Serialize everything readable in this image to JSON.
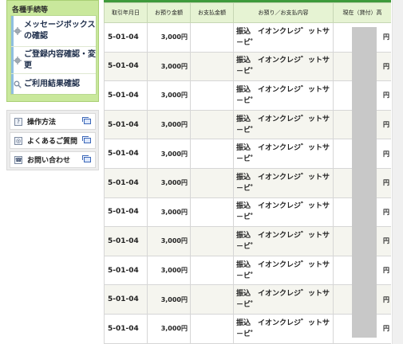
{
  "sidebar": {
    "procedures_title": "各種手続等",
    "procedures": [
      {
        "label": "メッセージボックスの確認",
        "icon": "gear-icon"
      },
      {
        "label": "ご登録内容確認・変更",
        "icon": "gear-icon"
      },
      {
        "label": "ご利用結果確認",
        "icon": "magnifier-icon"
      }
    ],
    "help": [
      {
        "label": "操作方法",
        "icon": "question-icon"
      },
      {
        "label": "よくあるご質問",
        "icon": "faq-icon"
      },
      {
        "label": "お問い合わせ",
        "icon": "phone-icon"
      }
    ]
  },
  "table": {
    "headers": [
      "取引年月日",
      "お預り金額",
      "お支払金額",
      "お預り／お支払内容",
      "現在（貸付）高"
    ],
    "rows": [
      {
        "date": "5-01-04",
        "deposit": "3,000円",
        "payment": "",
        "desc": "振込　イオンクレジ゛ットサ－ビ゜",
        "balance": "円"
      },
      {
        "date": "5-01-04",
        "deposit": "3,000円",
        "payment": "",
        "desc": "振込　イオンクレジ゛ットサ－ビ゜",
        "balance": "円"
      },
      {
        "date": "5-01-04",
        "deposit": "3,000円",
        "payment": "",
        "desc": "振込　イオンクレジ゛ットサ－ビ゜",
        "balance": "円"
      },
      {
        "date": "5-01-04",
        "deposit": "3,000円",
        "payment": "",
        "desc": "振込　イオンクレジ゛ットサ－ビ゜",
        "balance": "円"
      },
      {
        "date": "5-01-04",
        "deposit": "3,000円",
        "payment": "",
        "desc": "振込　イオンクレジ゛ットサ－ビ゜",
        "balance": "円"
      },
      {
        "date": "5-01-04",
        "deposit": "3,000円",
        "payment": "",
        "desc": "振込　イオンクレジ゛ットサ－ビ゜",
        "balance": "円"
      },
      {
        "date": "5-01-04",
        "deposit": "3,000円",
        "payment": "",
        "desc": "振込　イオンクレジ゛ットサ－ビ゜",
        "balance": "円"
      },
      {
        "date": "5-01-04",
        "deposit": "3,000円",
        "payment": "",
        "desc": "振込　イオンクレジ゛ットサ－ビ゜",
        "balance": "円"
      },
      {
        "date": "5-01-04",
        "deposit": "3,000円",
        "payment": "",
        "desc": "振込　イオンクレジ゛ットサ－ビ゜",
        "balance": "円"
      },
      {
        "date": "5-01-04",
        "deposit": "3,000円",
        "payment": "",
        "desc": "振込　イオンクレジ゛ットサ－ビ゜",
        "balance": "円"
      },
      {
        "date": "5-01-04",
        "deposit": "3,000円",
        "payment": "",
        "desc": "振込　イオンクレジ゛ットサ－ビ゜",
        "balance": "円"
      }
    ]
  },
  "colors": {
    "accent_green": "#3e9a3b",
    "sidebar_green": "#c9e89c",
    "header_bg": "#e6f3d3",
    "redaction": "#c8c8c8"
  }
}
